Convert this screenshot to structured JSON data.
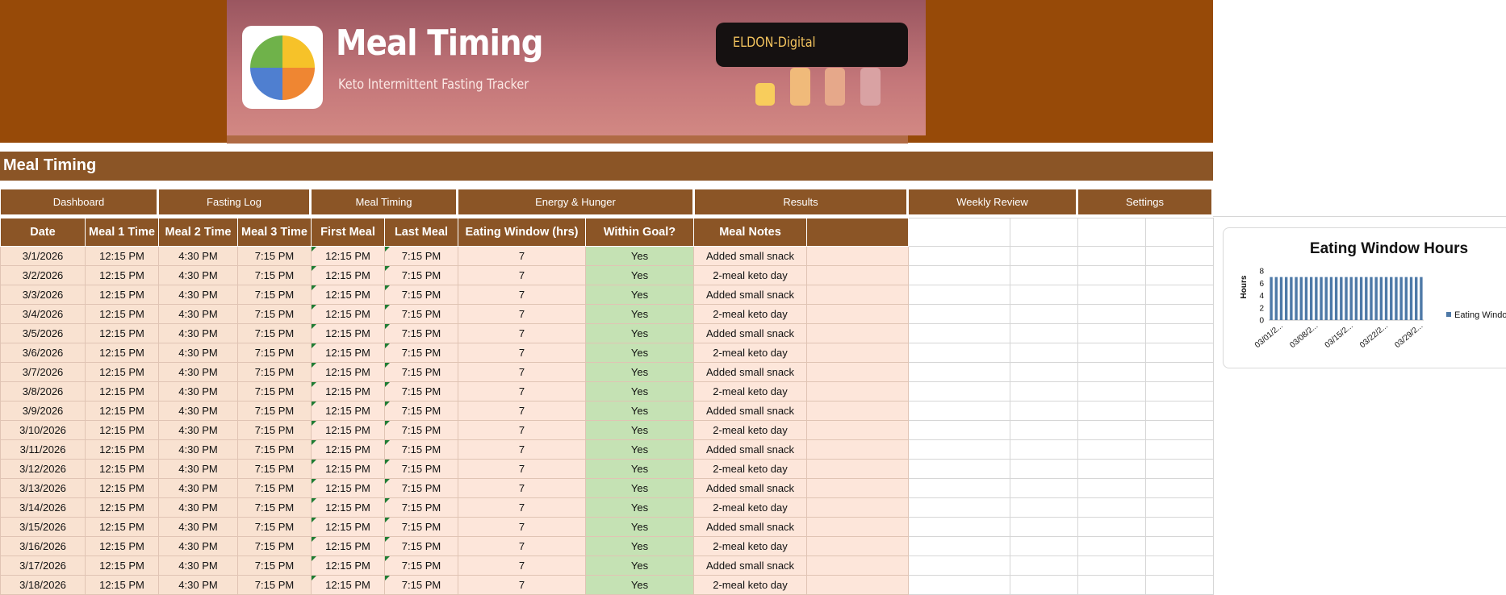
{
  "app": {
    "title": "Meal Timing",
    "subtitle": "Keto Intermittent Fasting Tracker",
    "brand": "ELDON-Digital",
    "logo_icon": "pie-chart-icon",
    "logo_colors": [
      "#f6c229",
      "#ef8632",
      "#4f7fd0",
      "#6fb24a"
    ],
    "bar_colors": [
      "#f8cd5c",
      "#f0ba7a",
      "#e6a88a",
      "#d9a2a3"
    ]
  },
  "section_title": "Meal Timing",
  "nav": [
    "Dashboard",
    "Fasting Log",
    "Meal Timing",
    "Energy & Hunger",
    "Results",
    "Weekly Review",
    "Settings"
  ],
  "table": {
    "headers": [
      "Date",
      "Meal 1 Time",
      "Meal 2 Time",
      "Meal 3 Time",
      "First Meal",
      "Last Meal",
      "Eating Window (hrs)",
      "Within Goal?",
      "Meal Notes",
      ""
    ],
    "rows": [
      [
        "3/1/2026",
        "12:15 PM",
        "4:30 PM",
        "7:15 PM",
        "12:15 PM",
        "7:15 PM",
        "7",
        "Yes",
        "Added small snack"
      ],
      [
        "3/2/2026",
        "12:15 PM",
        "4:30 PM",
        "7:15 PM",
        "12:15 PM",
        "7:15 PM",
        "7",
        "Yes",
        "2-meal keto day"
      ],
      [
        "3/3/2026",
        "12:15 PM",
        "4:30 PM",
        "7:15 PM",
        "12:15 PM",
        "7:15 PM",
        "7",
        "Yes",
        "Added small snack"
      ],
      [
        "3/4/2026",
        "12:15 PM",
        "4:30 PM",
        "7:15 PM",
        "12:15 PM",
        "7:15 PM",
        "7",
        "Yes",
        "2-meal keto day"
      ],
      [
        "3/5/2026",
        "12:15 PM",
        "4:30 PM",
        "7:15 PM",
        "12:15 PM",
        "7:15 PM",
        "7",
        "Yes",
        "Added small snack"
      ],
      [
        "3/6/2026",
        "12:15 PM",
        "4:30 PM",
        "7:15 PM",
        "12:15 PM",
        "7:15 PM",
        "7",
        "Yes",
        "2-meal keto day"
      ],
      [
        "3/7/2026",
        "12:15 PM",
        "4:30 PM",
        "7:15 PM",
        "12:15 PM",
        "7:15 PM",
        "7",
        "Yes",
        "Added small snack"
      ],
      [
        "3/8/2026",
        "12:15 PM",
        "4:30 PM",
        "7:15 PM",
        "12:15 PM",
        "7:15 PM",
        "7",
        "Yes",
        "2-meal keto day"
      ],
      [
        "3/9/2026",
        "12:15 PM",
        "4:30 PM",
        "7:15 PM",
        "12:15 PM",
        "7:15 PM",
        "7",
        "Yes",
        "Added small snack"
      ],
      [
        "3/10/2026",
        "12:15 PM",
        "4:30 PM",
        "7:15 PM",
        "12:15 PM",
        "7:15 PM",
        "7",
        "Yes",
        "2-meal keto day"
      ],
      [
        "3/11/2026",
        "12:15 PM",
        "4:30 PM",
        "7:15 PM",
        "12:15 PM",
        "7:15 PM",
        "7",
        "Yes",
        "Added small snack"
      ],
      [
        "3/12/2026",
        "12:15 PM",
        "4:30 PM",
        "7:15 PM",
        "12:15 PM",
        "7:15 PM",
        "7",
        "Yes",
        "2-meal keto day"
      ],
      [
        "3/13/2026",
        "12:15 PM",
        "4:30 PM",
        "7:15 PM",
        "12:15 PM",
        "7:15 PM",
        "7",
        "Yes",
        "Added small snack"
      ],
      [
        "3/14/2026",
        "12:15 PM",
        "4:30 PM",
        "7:15 PM",
        "12:15 PM",
        "7:15 PM",
        "7",
        "Yes",
        "2-meal keto day"
      ],
      [
        "3/15/2026",
        "12:15 PM",
        "4:30 PM",
        "7:15 PM",
        "12:15 PM",
        "7:15 PM",
        "7",
        "Yes",
        "Added small snack"
      ],
      [
        "3/16/2026",
        "12:15 PM",
        "4:30 PM",
        "7:15 PM",
        "12:15 PM",
        "7:15 PM",
        "7",
        "Yes",
        "2-meal keto day"
      ],
      [
        "3/17/2026",
        "12:15 PM",
        "4:30 PM",
        "7:15 PM",
        "12:15 PM",
        "7:15 PM",
        "7",
        "Yes",
        "Added small snack"
      ],
      [
        "3/18/2026",
        "12:15 PM",
        "4:30 PM",
        "7:15 PM",
        "12:15 PM",
        "7:15 PM",
        "7",
        "Yes",
        "2-meal keto day"
      ]
    ]
  },
  "chart_data": {
    "type": "bar",
    "title": "Eating Window Hours",
    "ylabel": "Hours",
    "ylim": [
      0,
      8
    ],
    "yticks": [
      0,
      2,
      4,
      6,
      8
    ],
    "xtick_labels": [
      "03/01/2...",
      "03/08/2...",
      "03/15/2...",
      "03/22/2...",
      "03/29/2..."
    ],
    "legend": "Eating Windo",
    "legend_position": "right",
    "color": "#4e79a7",
    "categories": [
      "03/01",
      "03/02",
      "03/03",
      "03/04",
      "03/05",
      "03/06",
      "03/07",
      "03/08",
      "03/09",
      "03/10",
      "03/11",
      "03/12",
      "03/13",
      "03/14",
      "03/15",
      "03/16",
      "03/17",
      "03/18",
      "03/19",
      "03/20",
      "03/21",
      "03/22",
      "03/23",
      "03/24",
      "03/25",
      "03/26",
      "03/27",
      "03/28",
      "03/29",
      "03/30",
      "03/31"
    ],
    "values": [
      7,
      7,
      7,
      7,
      7,
      7,
      7,
      7,
      7,
      7,
      7,
      7,
      7,
      7,
      7,
      7,
      7,
      7,
      7,
      7,
      7,
      7,
      7,
      7,
      7,
      7,
      7,
      7,
      7,
      7,
      7
    ]
  }
}
